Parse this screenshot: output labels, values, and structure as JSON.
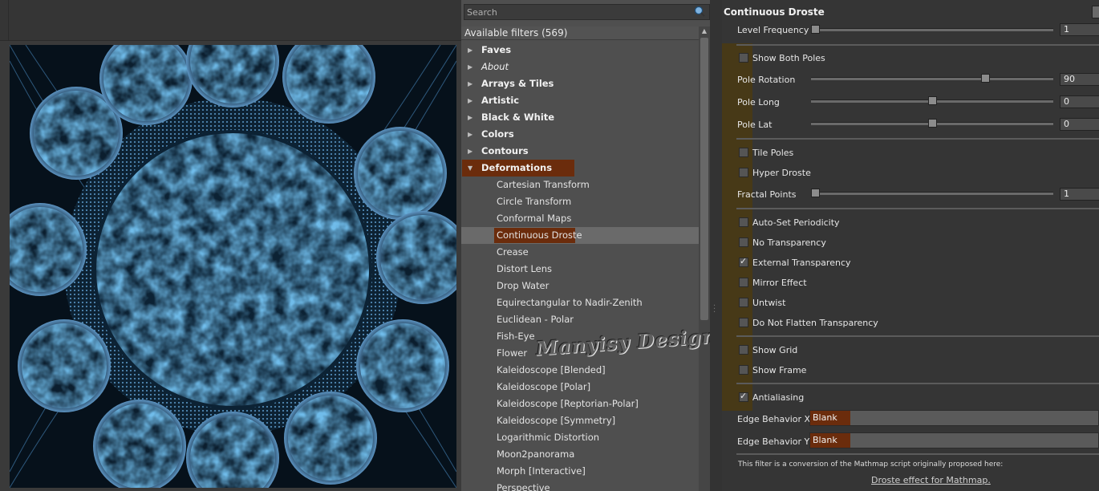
{
  "search": {
    "placeholder": "Search"
  },
  "filters": {
    "header": "Available filters (569)",
    "rows": [
      {
        "kind": "cat",
        "label": "Faves"
      },
      {
        "kind": "cat",
        "label": "About",
        "italic": true
      },
      {
        "kind": "cat",
        "label": "Arrays & Tiles"
      },
      {
        "kind": "cat",
        "label": "Artistic"
      },
      {
        "kind": "cat",
        "label": "Black & White"
      },
      {
        "kind": "cat",
        "label": "Colors"
      },
      {
        "kind": "cat",
        "label": "Contours"
      },
      {
        "kind": "cat",
        "label": "Deformations",
        "expanded": true,
        "selected": true
      },
      {
        "kind": "sub",
        "label": "Cartesian Transform"
      },
      {
        "kind": "sub",
        "label": "Circle Transform"
      },
      {
        "kind": "sub",
        "label": "Conformal Maps"
      },
      {
        "kind": "sub",
        "label": "Continuous Droste",
        "selected": true
      },
      {
        "kind": "sub",
        "label": "Crease"
      },
      {
        "kind": "sub",
        "label": "Distort Lens"
      },
      {
        "kind": "sub",
        "label": "Drop Water"
      },
      {
        "kind": "sub",
        "label": "Equirectangular to Nadir-Zenith"
      },
      {
        "kind": "sub",
        "label": "Euclidean - Polar"
      },
      {
        "kind": "sub",
        "label": "Fish-Eye"
      },
      {
        "kind": "sub",
        "label": "Flower"
      },
      {
        "kind": "sub",
        "label": "Kaleidoscope [Blended]"
      },
      {
        "kind": "sub",
        "label": "Kaleidoscope [Polar]"
      },
      {
        "kind": "sub",
        "label": "Kaleidoscope [Reptorian-Polar]"
      },
      {
        "kind": "sub",
        "label": "Kaleidoscope [Symmetry]"
      },
      {
        "kind": "sub",
        "label": "Logarithmic Distortion"
      },
      {
        "kind": "sub",
        "label": "Moon2panorama"
      },
      {
        "kind": "sub",
        "label": "Morph [Interactive]"
      },
      {
        "kind": "sub",
        "label": "Perspective"
      }
    ]
  },
  "watermark": "Manyisy Design",
  "settings": {
    "title": "Continuous Droste",
    "sliders": {
      "level_frequency": {
        "label": "Level Frequency",
        "value": "1",
        "fraction": 0.0
      },
      "pole_rotation": {
        "label": "Pole Rotation",
        "value": "90",
        "fraction": 0.73
      },
      "pole_long": {
        "label": "Pole Long",
        "value": "0",
        "fraction": 0.5
      },
      "pole_lat": {
        "label": "Pole Lat",
        "value": "0",
        "fraction": 0.5
      },
      "fractal_points": {
        "label": "Fractal Points",
        "value": "1",
        "fraction": 0.0
      }
    },
    "checks": {
      "show_both_poles": {
        "label": "Show Both Poles",
        "checked": false
      },
      "tile_poles": {
        "label": "Tile Poles",
        "checked": false
      },
      "hyper_droste": {
        "label": "Hyper Droste",
        "checked": false
      },
      "auto_set_periodicity": {
        "label": "Auto-Set Periodicity",
        "checked": false
      },
      "no_transparency": {
        "label": "No Transparency",
        "checked": false
      },
      "external_transparency": {
        "label": "External Transparency",
        "checked": true
      },
      "mirror_effect": {
        "label": "Mirror Effect",
        "checked": false
      },
      "untwist": {
        "label": "Untwist",
        "checked": false
      },
      "do_not_flatten": {
        "label": "Do Not Flatten Transparency",
        "checked": false
      },
      "show_grid": {
        "label": "Show Grid",
        "checked": false
      },
      "show_frame": {
        "label": "Show Frame",
        "checked": false
      },
      "antialiasing": {
        "label": "Antialiasing",
        "checked": true
      }
    },
    "edge_x": {
      "label": "Edge Behavior X",
      "value": "Blank"
    },
    "edge_y": {
      "label": "Edge Behavior Y",
      "value": "Blank"
    },
    "footer_text": "This filter is a conversion of the Mathmap script originally proposed here:",
    "footer_link": "Droste effect for Mathmap."
  },
  "colors": {
    "selection": "#6b2c0c",
    "preview_blue": "#3a8fd8",
    "preview_dark": "#07121d"
  }
}
